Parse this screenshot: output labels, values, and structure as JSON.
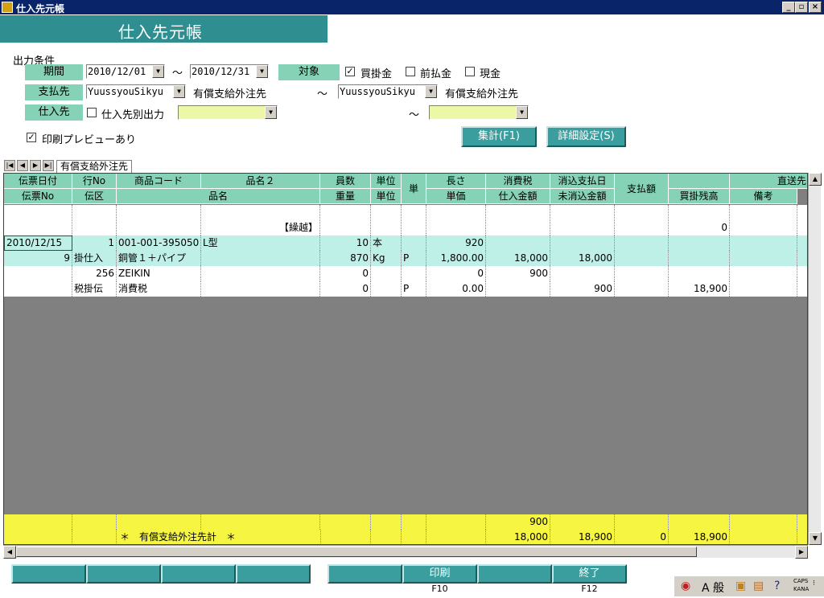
{
  "window": {
    "title": "仕入先元帳",
    "min": "_",
    "restore": "▫",
    "close": "×"
  },
  "header": {
    "title": "仕入先元帳"
  },
  "conditions": {
    "section_label": "出力条件",
    "period_label": "期間",
    "period_from": "2010/12/01",
    "period_to": "2010/12/31",
    "tilde": "～",
    "target_label": "対象",
    "target_options": [
      {
        "label": "買掛金",
        "checked": true
      },
      {
        "label": "前払金",
        "checked": false
      },
      {
        "label": "現金",
        "checked": false
      }
    ],
    "payee_label": "支払先",
    "payee_from_code": "YuussyouSikyu",
    "payee_from_name": "有償支給外注先",
    "payee_to_code": "YuussyouSikyu",
    "payee_to_name": "有償支給外注先",
    "supplier_label": "仕入先",
    "supplier_by_output": "仕入先別出力",
    "supplier_by_output_checked": false,
    "supplier_from": "",
    "supplier_to": "",
    "print_preview": "印刷プレビューあり",
    "print_preview_checked": true
  },
  "buttons": {
    "aggregate": "集計(F1)",
    "detail_settings": "詳細設定(S)"
  },
  "tab": {
    "label": "有償支給外注先"
  },
  "grid": {
    "header1": [
      "伝票日付",
      "行No",
      "商品コード",
      "品名２",
      "員数",
      "単位",
      "単",
      "長さ",
      "消費税",
      "消込支払日",
      "支払額",
      "",
      "直送先"
    ],
    "header2": [
      "伝票No",
      "伝区",
      "品名",
      "重量",
      "単位",
      "単価",
      "仕入金額",
      "未消込金額",
      "買掛残高",
      "備考"
    ],
    "carry": {
      "label": "【繰越】",
      "balance": "0"
    },
    "rows": [
      {
        "date": "2010/12/15",
        "line_no": "1",
        "code": "001-001-395050",
        "name2": "L型",
        "qty": "10",
        "unit1": "本",
        "length": "920",
        "slip_no": "9",
        "slip_type": "掛仕入",
        "name": "銅管１＋パイプ",
        "weight": "870",
        "unit2": "Kg",
        "tanka_flag": "P",
        "price": "1,800.00",
        "amount": "18,000",
        "uncleared": "18,000",
        "balance": ""
      },
      {
        "date": "",
        "line_no": "256",
        "code": "ZEIKIN",
        "name2": "",
        "qty": "0",
        "unit1": "",
        "length": "0",
        "tax": "900",
        "slip_no": "",
        "slip_type": "税掛伝",
        "name": "消費税",
        "weight": "0",
        "unit2": "",
        "tanka_flag": "P",
        "price": "0.00",
        "amount": "",
        "uncleared": "900",
        "balance": "18,900"
      }
    ],
    "total": {
      "tax": "900",
      "label": "＊　有償支給外注先計　＊",
      "amount": "18,000",
      "uncleared": "18,900",
      "paid": "0",
      "balance": "18,900"
    }
  },
  "fkeys": [
    {
      "label": "",
      "key": ""
    },
    {
      "label": "",
      "key": ""
    },
    {
      "label": "",
      "key": ""
    },
    {
      "label": "",
      "key": ""
    },
    {
      "label": "",
      "key": ""
    },
    {
      "label": "印刷",
      "key": "F10"
    },
    {
      "label": "",
      "key": ""
    },
    {
      "label": "終了",
      "key": "F12"
    }
  ],
  "tray": {
    "ime_mode": "A 般",
    "caps": "CAPS",
    "kana": "KANA"
  }
}
